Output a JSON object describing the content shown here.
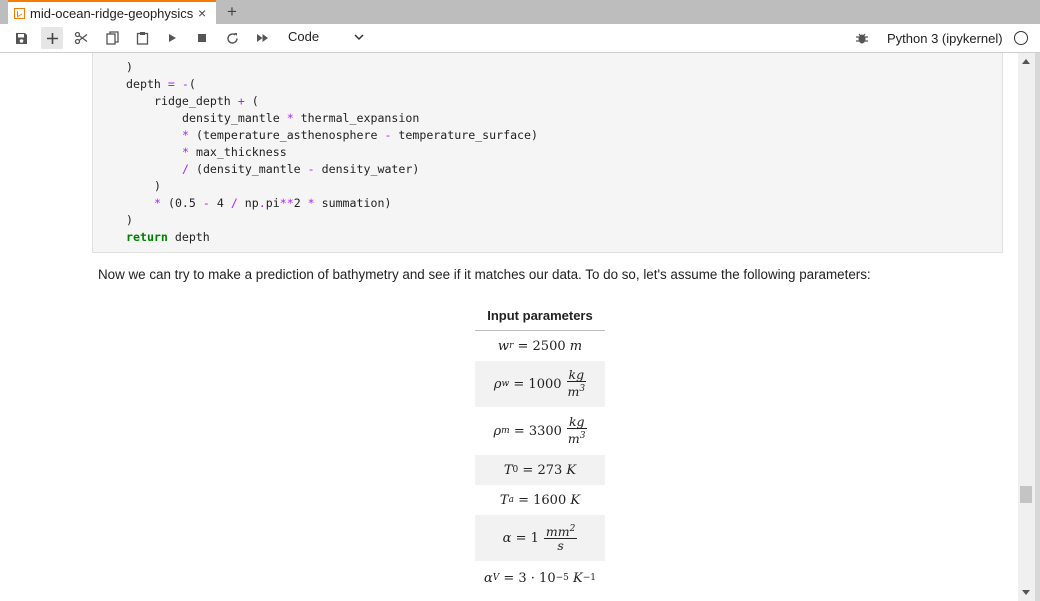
{
  "tab": {
    "title": "mid-ocean-ridge-geophysics",
    "close_label": "×",
    "new_tab_label": "+"
  },
  "toolbar": {
    "cell_type": "Code",
    "kernel_name": "Python 3 (ipykernel)"
  },
  "code_lines": [
    {
      "indent": "        ",
      "text": ")"
    },
    {
      "indent": "",
      "text": "    depth = -("
    },
    {
      "indent": "",
      "text": "        ridge_depth + ("
    },
    {
      "indent": "",
      "text": "            density_mantle * thermal_expansion"
    },
    {
      "indent": "",
      "text": "            * (temperature_asthenosphere - temperature_surface)"
    },
    {
      "indent": "",
      "text": "            * max_thickness"
    },
    {
      "indent": "",
      "text": "            / (density_mantle - density_water)"
    },
    {
      "indent": "",
      "text": "        )"
    },
    {
      "indent": "",
      "text": "        * (0.5 - 4 / np.pi**2 * summation)"
    },
    {
      "indent": "",
      "text": "    )"
    },
    {
      "indent": "",
      "text": "    return depth"
    }
  ],
  "markdown": {
    "paragraph": "Now we can try to make a prediction of bathymetry and see if it matches our data. To do so, let's assume the following parameters:"
  },
  "params": {
    "header": "Input parameters",
    "wr": {
      "lhs": "w",
      "sub": "r",
      "eq": " = 2500 ",
      "unit": "m"
    },
    "rho_w": {
      "lhs": "ρ",
      "sub": "w",
      "eq": " = 1000",
      "num": "kg",
      "den": "m",
      "den_sup": "3"
    },
    "rho_m": {
      "lhs": "ρ",
      "sub": "m",
      "eq": " = 3300",
      "num": "kg",
      "den": "m",
      "den_sup": "3"
    },
    "t0": {
      "lhs": "T",
      "sub": "0",
      "eq": " = 273 ",
      "unit": "K"
    },
    "ta": {
      "lhs": "T",
      "sub": "a",
      "eq": " = 1600 ",
      "unit": "K"
    },
    "alpha": {
      "lhs": "α",
      "eq": " = 1",
      "num": "mm",
      "num_sup": "2",
      "den": "s"
    },
    "alpha_v": {
      "lhs": "α",
      "sub": "V",
      "eq": " = 3 · 10",
      "exp": "−5",
      "unit": " K",
      "unit_sup": "−1"
    }
  }
}
